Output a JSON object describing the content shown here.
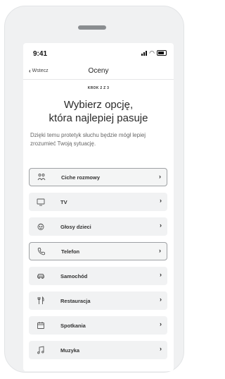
{
  "status_bar": {
    "time": "9:41"
  },
  "nav": {
    "back_label": "Wstecz",
    "title": "Oceny"
  },
  "step": "KROK 2 Z 3",
  "headline_line1": "Wybierz opcję,",
  "headline_line2": "która najlepiej pasuje",
  "subtitle": "Dzięki temu protetyk słuchu będzie mógł lepiej zrozumieć Twoją sytuację.",
  "options": [
    {
      "label": "Ciche rozmowy",
      "icon": "people-icon",
      "outlined": true
    },
    {
      "label": "TV",
      "icon": "tv-icon",
      "outlined": false
    },
    {
      "label": "Głosy dzieci",
      "icon": "child-icon",
      "outlined": false
    },
    {
      "label": "Telefon",
      "icon": "phone-icon",
      "outlined": true
    },
    {
      "label": "Samochód",
      "icon": "car-icon",
      "outlined": false
    },
    {
      "label": "Restauracja",
      "icon": "cutlery-icon",
      "outlined": false
    },
    {
      "label": "Spotkania",
      "icon": "calendar-icon",
      "outlined": false
    },
    {
      "label": "Muzyka",
      "icon": "music-icon",
      "outlined": false
    }
  ]
}
